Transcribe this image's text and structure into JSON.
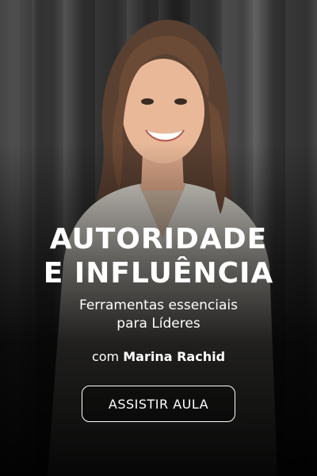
{
  "hero": {
    "title_line1": "AUTORIDADE",
    "title_line2": "E INFLUÊNCIA",
    "subtitle_line1": "Ferramentas essenciais",
    "subtitle_line2": "para Líderes",
    "presenter_prefix": "com",
    "presenter_name": "Marina Rachid",
    "cta_label": "ASSISTIR AULA"
  },
  "colors": {
    "text": "#ffffff",
    "background": "#0b0b0b"
  }
}
